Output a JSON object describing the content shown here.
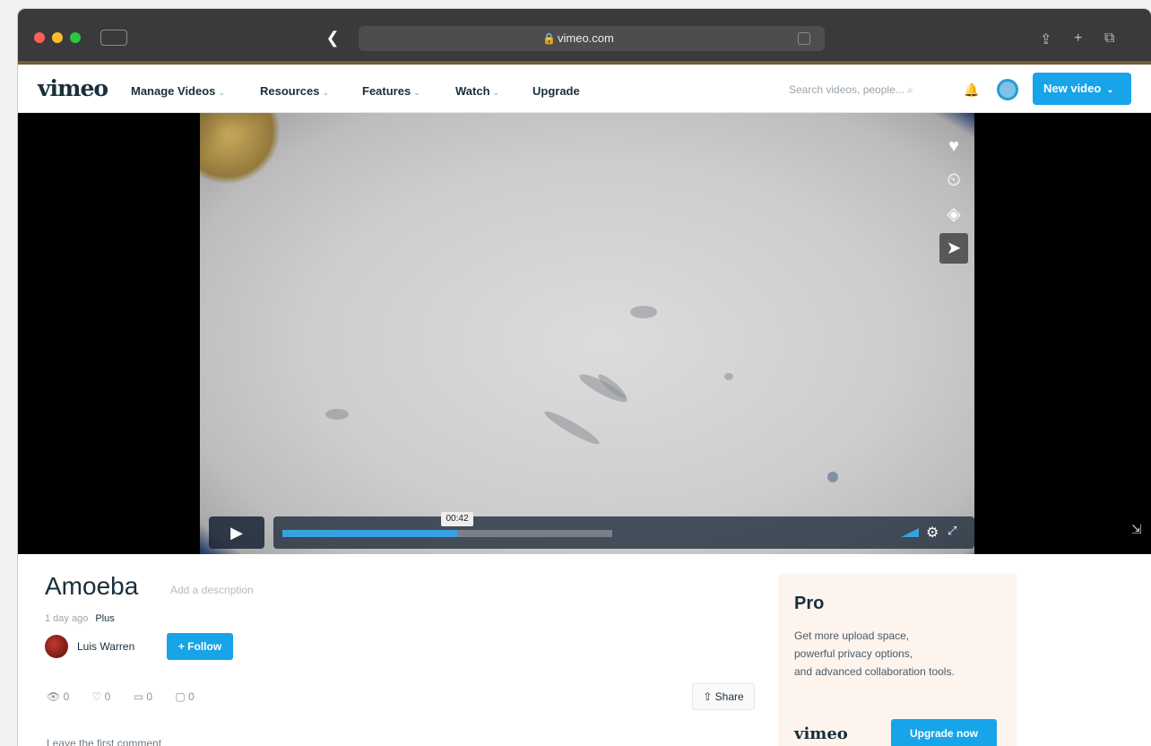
{
  "browser": {
    "url": "vimeo.com",
    "lock_icon": "lock-icon",
    "back_glyph": "❮",
    "sidebar_glyph": "",
    "share_glyph": "⇪",
    "newtab_glyph": "+",
    "tabs_glyph": "⧉"
  },
  "header": {
    "logo": "vimeo",
    "nav": [
      {
        "label": "Manage Videos"
      },
      {
        "label": "Resources"
      },
      {
        "label": "Features"
      },
      {
        "label": "Watch"
      },
      {
        "label": "Upgrade"
      }
    ],
    "chevron": "⌄",
    "search_placeholder": "Search videos, people...",
    "search_glyph": "⌕",
    "bell_glyph": "🔔",
    "new_video_label": "New video",
    "new_video_chev": "⌄"
  },
  "player": {
    "side_icons": [
      {
        "name": "heart-icon",
        "glyph": "♥"
      },
      {
        "name": "clock-icon",
        "glyph": "⏲"
      },
      {
        "name": "layers-icon",
        "glyph": "◈"
      },
      {
        "name": "send-icon",
        "glyph": "➤"
      }
    ],
    "play_glyph": "▶",
    "progress": 0.53,
    "time_tooltip": "00:42",
    "gear_glyph": "⚙",
    "fullscreen_glyph": "⤢",
    "corner_glyph": "⇲"
  },
  "video": {
    "title": "Amoeba",
    "title_sub": "Add a description",
    "meta_time": "1 day ago",
    "meta_tag": "Plus",
    "owner_name": "Luis Warren",
    "follow_label": "+ Follow",
    "stats": [
      "👁 0",
      "♡ 0",
      "▭ 0",
      "▢ 0"
    ],
    "share_label": "⇧ Share",
    "comment_prompt": "Leave the first comment"
  },
  "promo": {
    "title": "Pro",
    "lines": [
      "Get more upload space,",
      "powerful privacy options,",
      "and advanced collaboration tools."
    ],
    "logo": "vimeo",
    "upgrade_label": "Upgrade now"
  },
  "colors": {
    "accent": "#17a4e8",
    "header_text": "#1a2e3b",
    "browser_chrome": "#3a3a3c"
  }
}
